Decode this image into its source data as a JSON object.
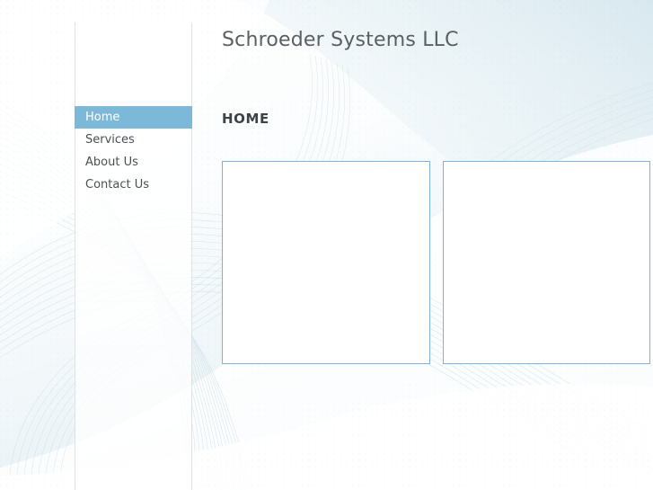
{
  "site": {
    "title": "Schroeder Systems LLC"
  },
  "nav": {
    "items": [
      {
        "label": "Home",
        "active": true
      },
      {
        "label": "Services",
        "active": false
      },
      {
        "label": "About Us",
        "active": false
      },
      {
        "label": "Contact Us",
        "active": false
      }
    ]
  },
  "main": {
    "heading": "HOME",
    "panels": [
      {
        "name": "left-content-panel",
        "text": ""
      },
      {
        "name": "right-content-panel",
        "text": ""
      }
    ]
  },
  "colors": {
    "accent": "#7cb9d9",
    "panel_border": "#7ab4dd",
    "title_text": "#5a5f63",
    "nav_text": "#4a4f54",
    "heading_text": "#3d4246",
    "page_background": "#eef5f8"
  }
}
